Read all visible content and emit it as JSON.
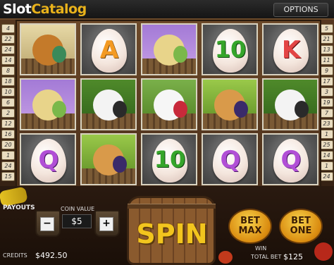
{
  "header": {
    "logo_slot": "Slot",
    "logo_catalog": "Catalog",
    "options_label": "OPTIONS"
  },
  "paylines": {
    "left": [
      "4",
      "22",
      "24",
      "14",
      "8",
      "18",
      "10",
      "6",
      "2",
      "12",
      "16",
      "20",
      "1",
      "24",
      "15"
    ],
    "right": [
      "5",
      "21",
      "13",
      "11",
      "9",
      "17",
      "3",
      "19",
      "7",
      "23",
      "1",
      "25",
      "14",
      "1",
      "24"
    ]
  },
  "reels": [
    [
      {
        "type": "pic",
        "icon": "duck-icon"
      },
      {
        "type": "pic",
        "icon": "horse-icon"
      },
      {
        "type": "letter",
        "text": "Q",
        "color": "purple"
      }
    ],
    [
      {
        "type": "letter",
        "text": "A",
        "color": "orange"
      },
      {
        "type": "pic",
        "icon": "cow-icon"
      },
      {
        "type": "pic",
        "icon": "scarecrow-icon"
      }
    ],
    [
      {
        "type": "pic",
        "icon": "horse-icon"
      },
      {
        "type": "pic",
        "icon": "hen-icon"
      },
      {
        "type": "letter",
        "text": "10",
        "color": "green"
      }
    ],
    [
      {
        "type": "letter",
        "text": "10",
        "color": "green"
      },
      {
        "type": "pic",
        "icon": "scarecrow-icon"
      },
      {
        "type": "letter",
        "text": "Q",
        "color": "purple"
      }
    ],
    [
      {
        "type": "letter",
        "text": "K",
        "color": "red"
      },
      {
        "type": "pic",
        "icon": "cow-icon"
      },
      {
        "type": "letter",
        "text": "Q",
        "color": "purple"
      }
    ]
  ],
  "controls": {
    "payouts_label": "PAYOUTS",
    "coin_value_label": "COIN VALUE",
    "coin_value": "$5",
    "minus_label": "−",
    "plus_label": "+",
    "credits_label": "CREDITS",
    "credits_value": "$492.50",
    "spin_label": "SPIN",
    "bet_max_label": "BET MAX",
    "bet_one_label": "BET ONE",
    "win_label": "WIN",
    "total_bet_label": "TOTAL BET",
    "total_bet_value": "$125"
  }
}
